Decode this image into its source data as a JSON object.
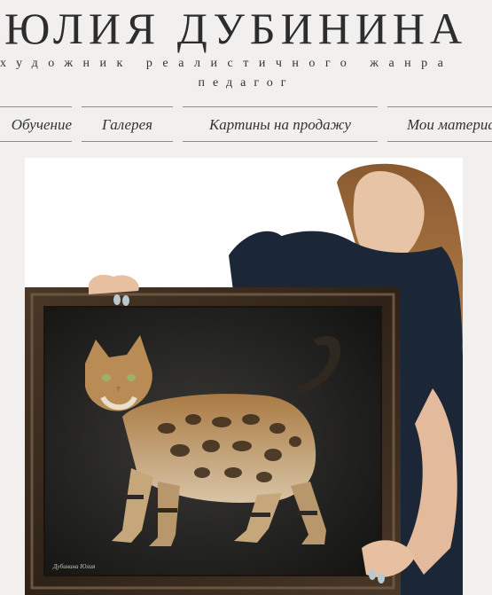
{
  "header": {
    "title": "ЮЛИЯ ДУБИНИНА",
    "tagline_line1": "художник реалистичного жанра",
    "tagline_line2": "педагог"
  },
  "nav": {
    "items": [
      {
        "label": "Обучение"
      },
      {
        "label": "Галерея"
      },
      {
        "label": "Картины на продажу"
      },
      {
        "label": "Мои материалы"
      }
    ]
  },
  "hero": {
    "painting_signature": "Дубинина Юлия",
    "subject": "artist holding framed painting of a bengal cat",
    "colors": {
      "frame": "#3b2c20",
      "canvas": "#1c1c1a",
      "shirt": "#1b2636",
      "hair": "#9a6a3c"
    }
  }
}
